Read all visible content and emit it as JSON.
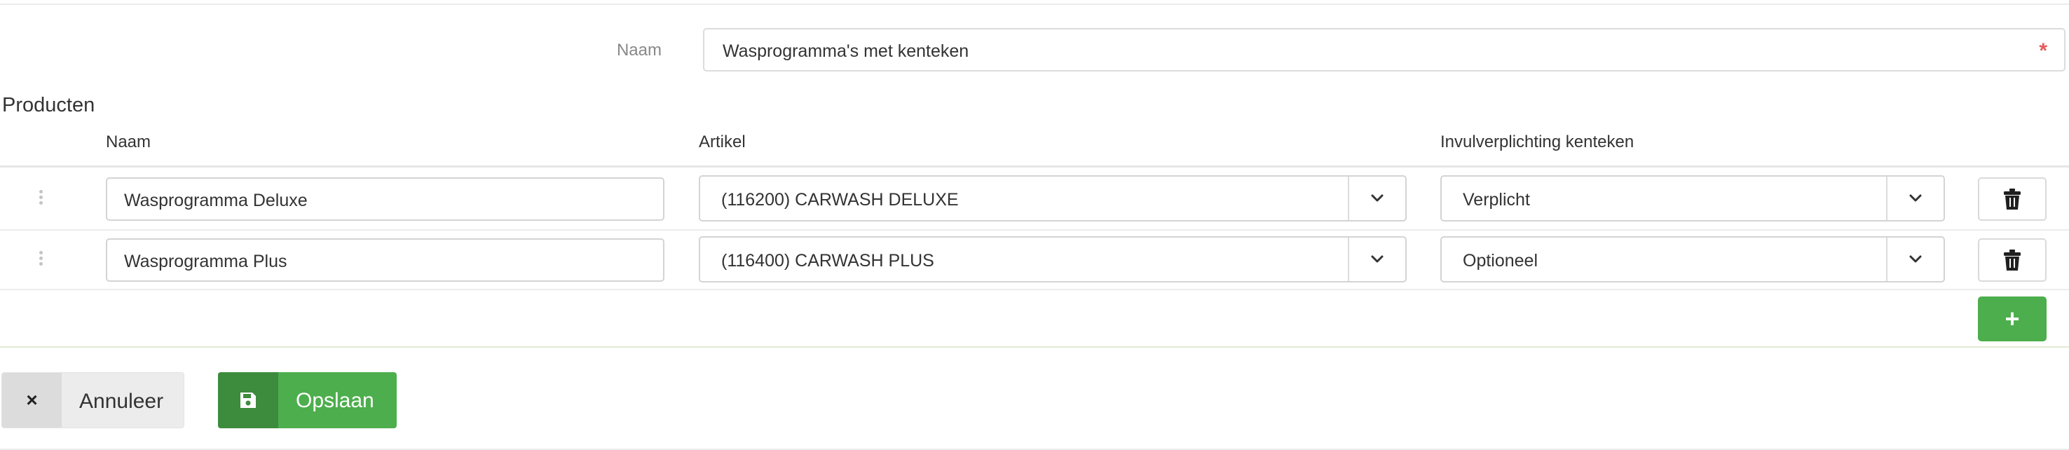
{
  "form": {
    "name_label": "Naam",
    "name_value": "Wasprogramma's met kenteken",
    "required_mark": "*"
  },
  "products": {
    "title": "Producten",
    "headers": {
      "naam": "Naam",
      "artikel": "Artikel",
      "invulverplichting": "Invulverplichting kenteken"
    },
    "rows": [
      {
        "naam": "Wasprogramma Deluxe",
        "artikel": "(116200) CARWASH DELUXE",
        "invulverplichting": "Verplicht"
      },
      {
        "naam": "Wasprogramma Plus",
        "artikel": "(116400) CARWASH PLUS",
        "invulverplichting": "Optioneel"
      }
    ],
    "add_label": "+"
  },
  "actions": {
    "cancel_icon": "×",
    "cancel_label": "Annuleer",
    "save_label": "Opslaan"
  },
  "icons": {
    "drag": "drag-handle-icon",
    "caret": "chevron-down-icon",
    "delete": "trash-icon",
    "save": "floppy-disk-icon",
    "cancel": "close-icon"
  },
  "colors": {
    "success": "#4cae4c",
    "success_dark": "#3d8b3d",
    "required": "#e25c5c"
  }
}
